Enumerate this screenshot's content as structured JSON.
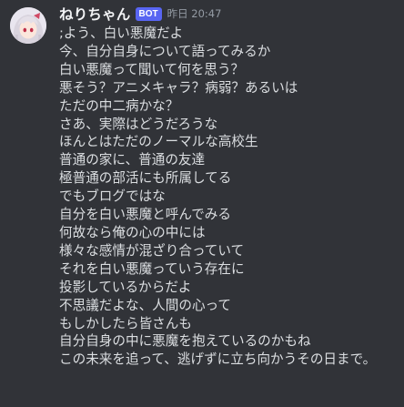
{
  "message": {
    "username": "ねりちゃん",
    "bot_tag": "BOT",
    "timestamp": "昨日 20:47",
    "avatar_icon": "avatar-anime-character-icon",
    "lines": [
      ";よう、白い悪魔だよ",
      "今、自分自身について語ってみるか",
      "白い悪魔って聞いて何を思う？",
      "悪そう？アニメキャラ？病弱？あるいは",
      "ただの中二病かな？",
      "さあ、実際はどうだろうな",
      "ほんとはただのノーマルな高校生",
      "普通の家に、普通の友達",
      "極普通の部活にも所属してる",
      "でもブログではな",
      "自分を白い悪魔と呼んでみる",
      "何故なら俺の心の中には",
      "様々な感情が混ざり合っていて",
      "それを白い悪魔っていう存在に",
      "投影しているからだよ",
      "不思議だよな、人間の心って",
      "もしかしたら皆さんも",
      "自分自身の中に悪魔を抱えているのかもね",
      "この未来を追って、逃げずに立ち向かうその日まで。"
    ]
  },
  "colors": {
    "background": "#313338",
    "username": "#f2f3f5",
    "bot_tag_bg": "#5865f2",
    "timestamp": "#949ba4",
    "text": "#dbdee1"
  }
}
